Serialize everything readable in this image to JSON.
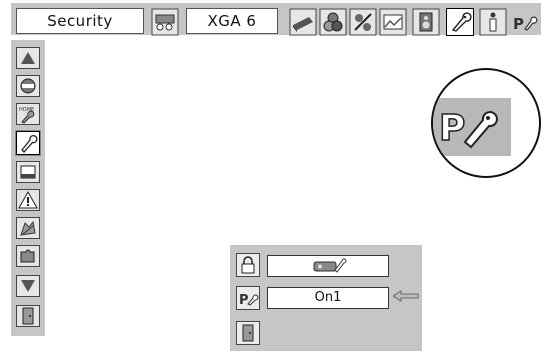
{
  "topbar": {
    "menu_title": "Security",
    "resolution": "XGA 6",
    "icons": [
      "input-icon",
      "display-icon",
      "color-icon",
      "setting-icon",
      "expand-icon",
      "sound-icon",
      "security-icon",
      "info-icon",
      "pin-code-icon"
    ]
  },
  "sidebar": {
    "items": [
      "up-arrow-icon",
      "lock-exit-icon",
      "home-setting-icon",
      "key-icon",
      "screen-icon",
      "warning-icon",
      "hand-tool-icon",
      "puzzle-icon",
      "down-arrow-icon",
      "exit-door-icon"
    ]
  },
  "panel": {
    "lock_value_icon": "projector-lock-icon",
    "pin_value": "On1"
  },
  "colors": {
    "bar_gray": "#c6c6c6",
    "icon_bg": "#e6e6e6",
    "border": "#444444"
  }
}
